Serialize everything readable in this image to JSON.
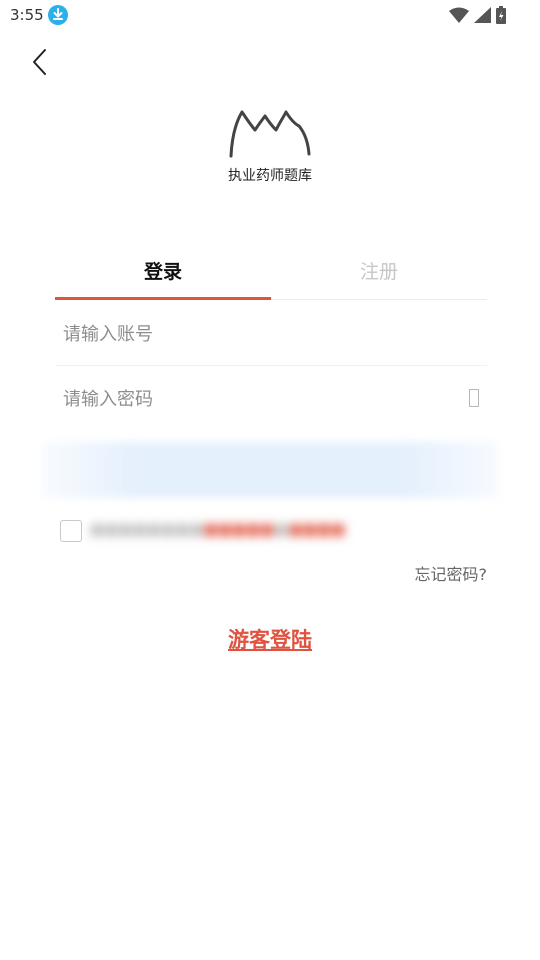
{
  "status_bar": {
    "time": "3:55"
  },
  "app": {
    "name": "执业药师题库"
  },
  "tabs": {
    "login": "登录",
    "register": "注册"
  },
  "form": {
    "account_placeholder": "请输入账号",
    "account_value": "",
    "password_placeholder": "请输入密码",
    "password_value": ""
  },
  "links": {
    "forgot_password": "忘记密码?",
    "guest_login": "游客登陆"
  },
  "colors": {
    "accent": "#e0533f",
    "download_badge": "#2ab1ea"
  }
}
